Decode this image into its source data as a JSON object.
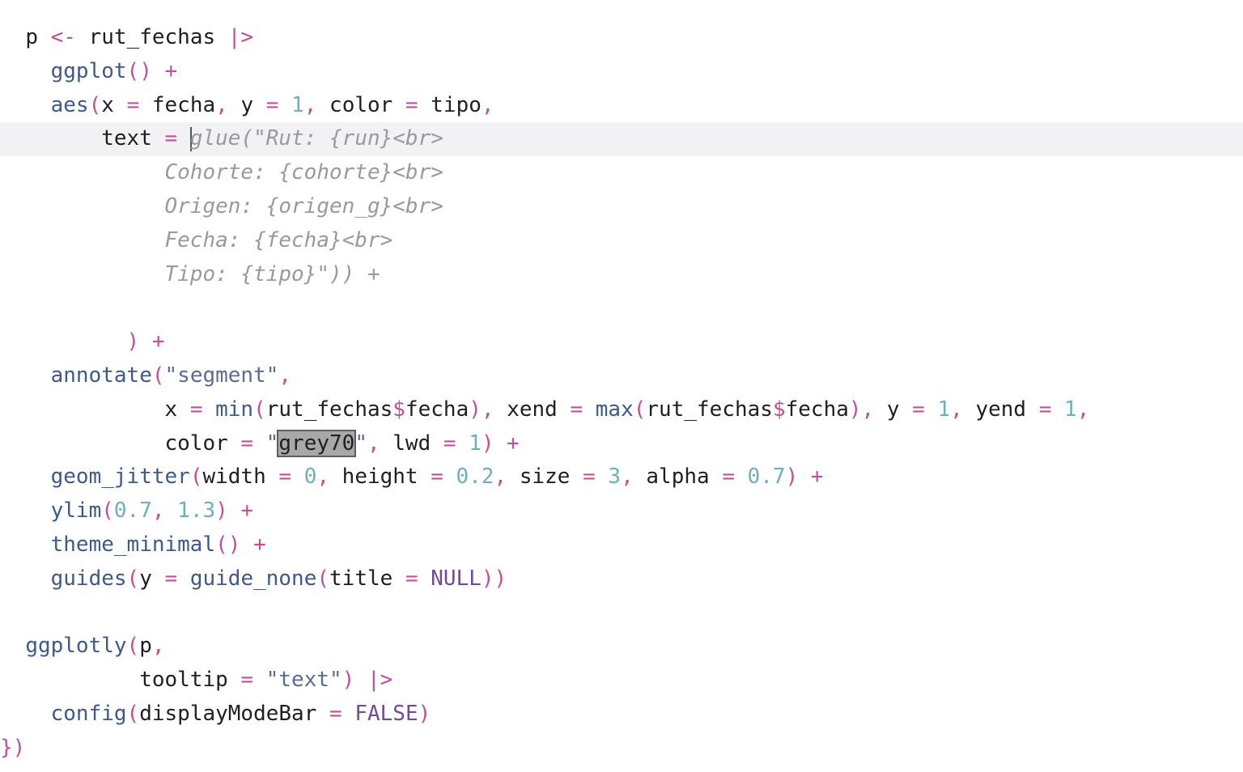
{
  "editor": {
    "lines": [
      {
        "indent": "  ",
        "tokens": [
          {
            "t": "p ",
            "c": "var"
          },
          {
            "t": "<-",
            "c": "op"
          },
          {
            "t": " rut_fechas ",
            "c": "var"
          },
          {
            "t": "|>",
            "c": "op"
          }
        ]
      },
      {
        "indent": "    ",
        "tokens": [
          {
            "t": "ggplot",
            "c": "fn"
          },
          {
            "t": "()",
            "c": "op"
          },
          {
            "t": " +",
            "c": "op"
          }
        ]
      },
      {
        "indent": "    ",
        "tokens": [
          {
            "t": "aes",
            "c": "fn"
          },
          {
            "t": "(",
            "c": "op"
          },
          {
            "t": "x ",
            "c": "var"
          },
          {
            "t": "=",
            "c": "op"
          },
          {
            "t": " fecha",
            "c": "var"
          },
          {
            "t": ",",
            "c": "op"
          },
          {
            "t": " y ",
            "c": "var"
          },
          {
            "t": "=",
            "c": "op"
          },
          {
            "t": " 1",
            "c": "num"
          },
          {
            "t": ",",
            "c": "op"
          },
          {
            "t": " color ",
            "c": "var"
          },
          {
            "t": "=",
            "c": "op"
          },
          {
            "t": " tipo",
            "c": "var"
          },
          {
            "t": ",",
            "c": "op"
          }
        ]
      },
      {
        "indent": "        ",
        "current": true,
        "tokens": [
          {
            "t": "text ",
            "c": "var"
          },
          {
            "t": "=",
            "c": "op"
          },
          {
            "t": " ",
            "c": "var"
          },
          {
            "t": "",
            "c": "cursor"
          },
          {
            "t": "glue(\"Rut: {run}<br>",
            "c": "ghost"
          }
        ]
      },
      {
        "indent": "             ",
        "tokens": [
          {
            "t": "Cohorte: {cohorte}<br>",
            "c": "ghost"
          }
        ]
      },
      {
        "indent": "             ",
        "tokens": [
          {
            "t": "Origen: {origen_g}<br>",
            "c": "ghost"
          }
        ]
      },
      {
        "indent": "             ",
        "tokens": [
          {
            "t": "Fecha: {fecha}<br>",
            "c": "ghost"
          }
        ]
      },
      {
        "indent": "             ",
        "tokens": [
          {
            "t": "Tipo: {tipo}\")) +",
            "c": "ghost"
          }
        ]
      },
      {
        "indent": "",
        "tokens": []
      },
      {
        "indent": "          ",
        "tokens": [
          {
            "t": ")",
            "c": "op"
          },
          {
            "t": " +",
            "c": "op"
          }
        ]
      },
      {
        "indent": "    ",
        "tokens": [
          {
            "t": "annotate",
            "c": "fn"
          },
          {
            "t": "(",
            "c": "op"
          },
          {
            "t": "\"segment\"",
            "c": "str"
          },
          {
            "t": ",",
            "c": "op"
          }
        ]
      },
      {
        "indent": "             ",
        "tokens": [
          {
            "t": "x ",
            "c": "var"
          },
          {
            "t": "=",
            "c": "op"
          },
          {
            "t": " ",
            "c": "var"
          },
          {
            "t": "min",
            "c": "fn"
          },
          {
            "t": "(",
            "c": "op"
          },
          {
            "t": "rut_fechas",
            "c": "var"
          },
          {
            "t": "$",
            "c": "op"
          },
          {
            "t": "fecha",
            "c": "var"
          },
          {
            "t": "),",
            "c": "op"
          },
          {
            "t": " xend ",
            "c": "var"
          },
          {
            "t": "=",
            "c": "op"
          },
          {
            "t": " ",
            "c": "var"
          },
          {
            "t": "max",
            "c": "fn"
          },
          {
            "t": "(",
            "c": "op"
          },
          {
            "t": "rut_fechas",
            "c": "var"
          },
          {
            "t": "$",
            "c": "op"
          },
          {
            "t": "fecha",
            "c": "var"
          },
          {
            "t": "),",
            "c": "op"
          },
          {
            "t": " y ",
            "c": "var"
          },
          {
            "t": "=",
            "c": "op"
          },
          {
            "t": " 1",
            "c": "num"
          },
          {
            "t": ",",
            "c": "op"
          },
          {
            "t": " yend ",
            "c": "var"
          },
          {
            "t": "=",
            "c": "op"
          },
          {
            "t": " 1",
            "c": "num"
          },
          {
            "t": ",",
            "c": "op"
          }
        ]
      },
      {
        "indent": "             ",
        "tokens": [
          {
            "t": "color ",
            "c": "var"
          },
          {
            "t": "=",
            "c": "op"
          },
          {
            "t": " \"",
            "c": "str"
          },
          {
            "t": "grey70",
            "c": "sel"
          },
          {
            "t": "\"",
            "c": "str"
          },
          {
            "t": ",",
            "c": "op"
          },
          {
            "t": " lwd ",
            "c": "var"
          },
          {
            "t": "=",
            "c": "op"
          },
          {
            "t": " 1",
            "c": "num"
          },
          {
            "t": ")",
            "c": "op"
          },
          {
            "t": " +",
            "c": "op"
          }
        ]
      },
      {
        "indent": "    ",
        "tokens": [
          {
            "t": "geom_jitter",
            "c": "fn"
          },
          {
            "t": "(",
            "c": "op"
          },
          {
            "t": "width ",
            "c": "var"
          },
          {
            "t": "=",
            "c": "op"
          },
          {
            "t": " 0",
            "c": "num"
          },
          {
            "t": ",",
            "c": "op"
          },
          {
            "t": " height ",
            "c": "var"
          },
          {
            "t": "=",
            "c": "op"
          },
          {
            "t": " 0.2",
            "c": "num"
          },
          {
            "t": ",",
            "c": "op"
          },
          {
            "t": " size ",
            "c": "var"
          },
          {
            "t": "=",
            "c": "op"
          },
          {
            "t": " 3",
            "c": "num"
          },
          {
            "t": ",",
            "c": "op"
          },
          {
            "t": " alpha ",
            "c": "var"
          },
          {
            "t": "=",
            "c": "op"
          },
          {
            "t": " 0.7",
            "c": "num"
          },
          {
            "t": ")",
            "c": "op"
          },
          {
            "t": " +",
            "c": "op"
          }
        ]
      },
      {
        "indent": "    ",
        "tokens": [
          {
            "t": "ylim",
            "c": "fn"
          },
          {
            "t": "(",
            "c": "op"
          },
          {
            "t": "0.7",
            "c": "num"
          },
          {
            "t": ",",
            "c": "op"
          },
          {
            "t": " 1.3",
            "c": "num"
          },
          {
            "t": ")",
            "c": "op"
          },
          {
            "t": " +",
            "c": "op"
          }
        ]
      },
      {
        "indent": "    ",
        "tokens": [
          {
            "t": "theme_minimal",
            "c": "fn"
          },
          {
            "t": "()",
            "c": "op"
          },
          {
            "t": " +",
            "c": "op"
          }
        ]
      },
      {
        "indent": "    ",
        "tokens": [
          {
            "t": "guides",
            "c": "fn"
          },
          {
            "t": "(",
            "c": "op"
          },
          {
            "t": "y ",
            "c": "var"
          },
          {
            "t": "=",
            "c": "op"
          },
          {
            "t": " ",
            "c": "var"
          },
          {
            "t": "guide_none",
            "c": "fn"
          },
          {
            "t": "(",
            "c": "op"
          },
          {
            "t": "title ",
            "c": "var"
          },
          {
            "t": "=",
            "c": "op"
          },
          {
            "t": " NULL",
            "c": "kw"
          },
          {
            "t": "))",
            "c": "op"
          }
        ]
      },
      {
        "indent": "",
        "tokens": []
      },
      {
        "indent": "  ",
        "tokens": [
          {
            "t": "ggplotly",
            "c": "fn"
          },
          {
            "t": "(",
            "c": "op"
          },
          {
            "t": "p",
            "c": "var"
          },
          {
            "t": ",",
            "c": "op"
          }
        ]
      },
      {
        "indent": "           ",
        "tokens": [
          {
            "t": "tooltip ",
            "c": "var"
          },
          {
            "t": "=",
            "c": "op"
          },
          {
            "t": " \"text\"",
            "c": "str"
          },
          {
            "t": ")",
            "c": "op"
          },
          {
            "t": " |>",
            "c": "op"
          }
        ]
      },
      {
        "indent": "    ",
        "tokens": [
          {
            "t": "config",
            "c": "fn"
          },
          {
            "t": "(",
            "c": "op"
          },
          {
            "t": "displayModeBar ",
            "c": "var"
          },
          {
            "t": "=",
            "c": "op"
          },
          {
            "t": " FALSE",
            "c": "kw"
          },
          {
            "t": ")",
            "c": "op"
          }
        ]
      },
      {
        "indent": "",
        "tokens": [
          {
            "t": "})",
            "c": "op"
          }
        ]
      }
    ]
  }
}
